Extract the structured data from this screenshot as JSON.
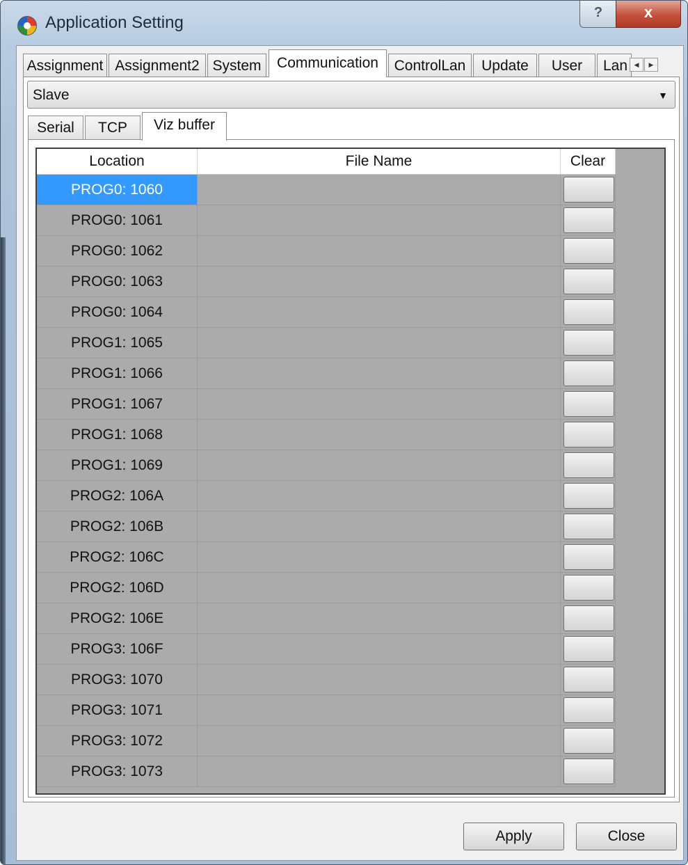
{
  "window": {
    "title": "Application Setting",
    "help_glyph": "?",
    "close_glyph": "x"
  },
  "main_tabs": [
    {
      "label": "Assignment"
    },
    {
      "label": "Assignment2"
    },
    {
      "label": "System"
    },
    {
      "label": "Communication",
      "active": true
    },
    {
      "label": "ControlLan"
    },
    {
      "label": "Update"
    },
    {
      "label": "User"
    },
    {
      "label": "Lan"
    }
  ],
  "tab_scroll": {
    "left": "◀",
    "right": "▶"
  },
  "mode_select": {
    "value": "Slave",
    "arrow": "▼"
  },
  "sub_tabs": [
    {
      "label": "Serial"
    },
    {
      "label": "TCP"
    },
    {
      "label": "Viz buffer",
      "active": true
    }
  ],
  "grid": {
    "columns": [
      "Location",
      "File Name",
      "Clear"
    ],
    "rows": [
      {
        "location": "PROG0: 1060",
        "file_name": "",
        "selected": true
      },
      {
        "location": "PROG0: 1061",
        "file_name": ""
      },
      {
        "location": "PROG0: 1062",
        "file_name": ""
      },
      {
        "location": "PROG0: 1063",
        "file_name": ""
      },
      {
        "location": "PROG0: 1064",
        "file_name": ""
      },
      {
        "location": "PROG1: 1065",
        "file_name": ""
      },
      {
        "location": "PROG1: 1066",
        "file_name": ""
      },
      {
        "location": "PROG1: 1067",
        "file_name": ""
      },
      {
        "location": "PROG1: 1068",
        "file_name": ""
      },
      {
        "location": "PROG1: 1069",
        "file_name": ""
      },
      {
        "location": "PROG2: 106A",
        "file_name": ""
      },
      {
        "location": "PROG2: 106B",
        "file_name": ""
      },
      {
        "location": "PROG2: 106C",
        "file_name": ""
      },
      {
        "location": "PROG2: 106D",
        "file_name": ""
      },
      {
        "location": "PROG2: 106E",
        "file_name": ""
      },
      {
        "location": "PROG3: 106F",
        "file_name": ""
      },
      {
        "location": "PROG3: 1070",
        "file_name": ""
      },
      {
        "location": "PROG3: 1071",
        "file_name": ""
      },
      {
        "location": "PROG3: 1072",
        "file_name": ""
      },
      {
        "location": "PROG3: 1073",
        "file_name": ""
      }
    ]
  },
  "buttons": {
    "apply": "Apply",
    "close": "Close"
  },
  "colors": {
    "selection": "#3399ff",
    "grid_background": "#ababab",
    "close_button": "#c4503c"
  }
}
